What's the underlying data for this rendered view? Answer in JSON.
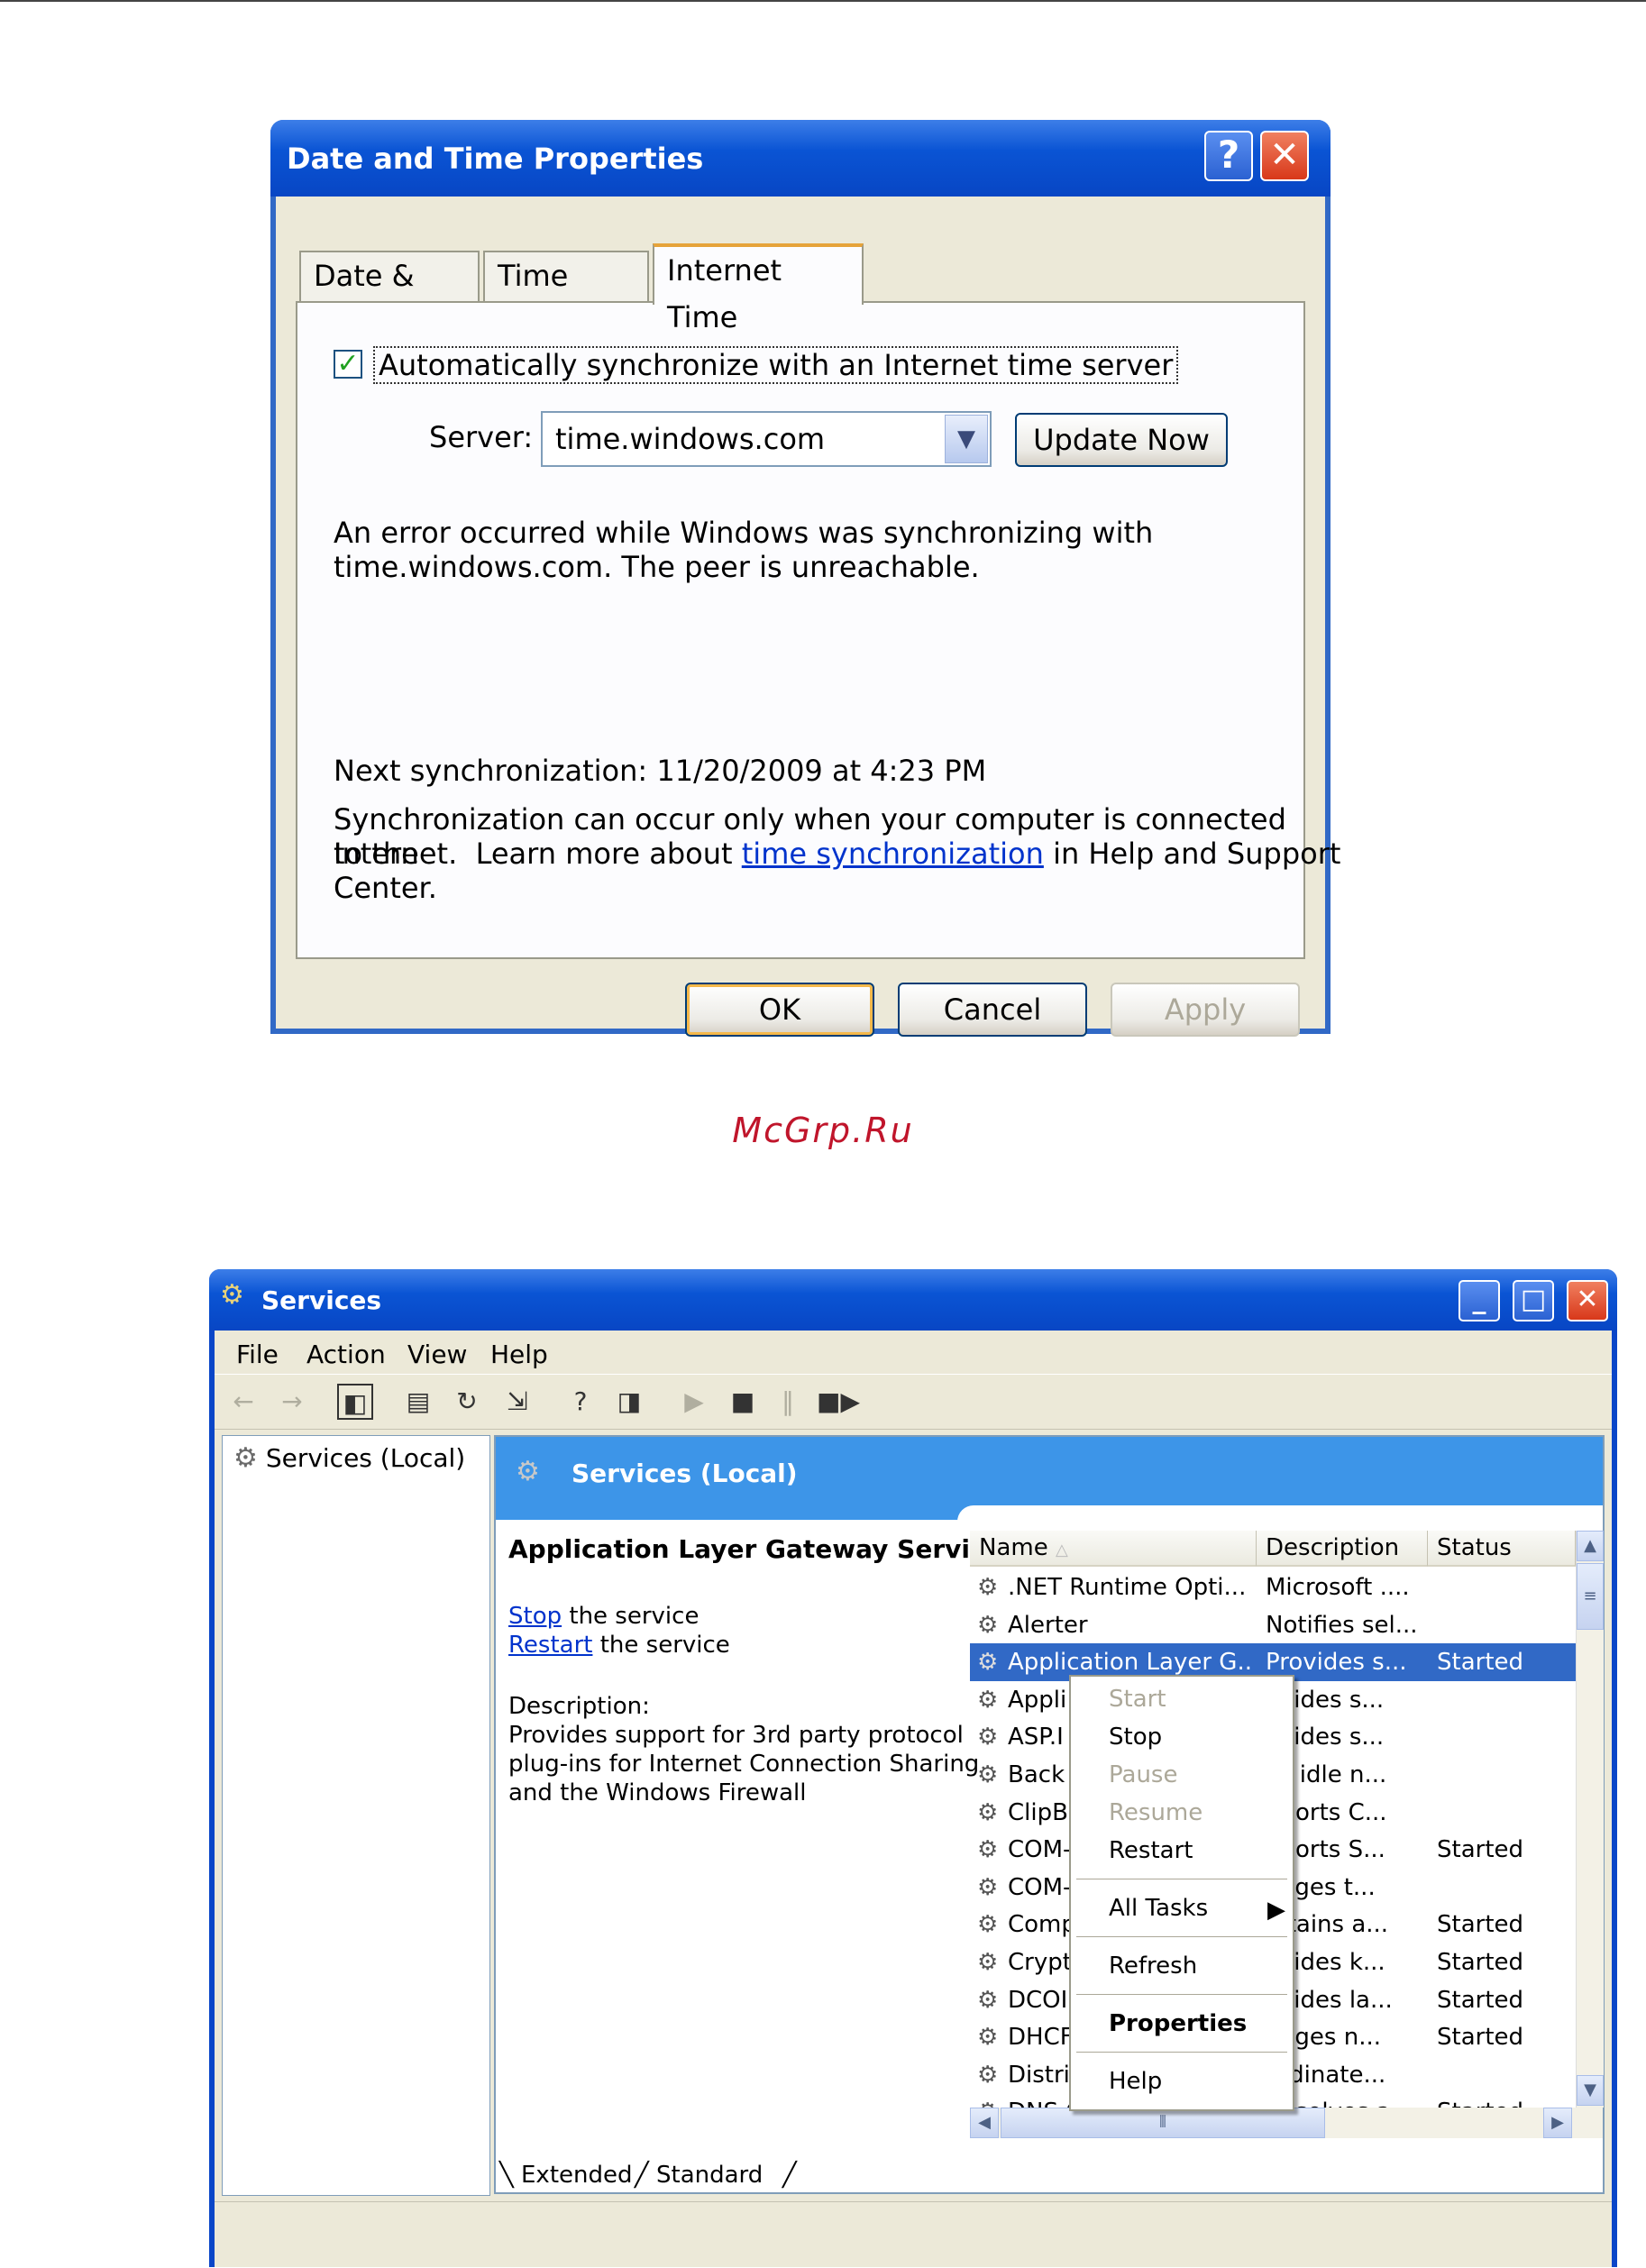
{
  "watermark": "McGrp.Ru",
  "dialog": {
    "title": "Date and Time Properties",
    "help_glyph": "?",
    "close_glyph": "✕",
    "tabs": [
      "Date & Time",
      "Time Zone",
      "Internet Time"
    ],
    "active_tab": "Internet Time",
    "checkbox_label": "Automatically synchronize with an Internet time server",
    "checkbox_checked": true,
    "server_label": "Server:",
    "server_value": "time.windows.com",
    "update_button": "Update Now",
    "error_line1": "An error occurred while Windows was synchronizing with",
    "error_line2": "time.windows.com.  The peer is unreachable.",
    "next_sync": "Next synchronization: 11/20/2009 at 4:23 PM",
    "info_line1": "Synchronization can occur only when your computer is connected to the",
    "info_line2_pre": "Internet.  Learn more about ",
    "info_link": "time synchronization",
    "info_line2_post": " in Help and Support",
    "info_line3": "Center.",
    "ok_button": "OK",
    "cancel_button": "Cancel",
    "apply_button": "Apply"
  },
  "services": {
    "title": "Services",
    "menu": [
      "File",
      "Action",
      "View",
      "Help"
    ],
    "tree_item": "Services (Local)",
    "header_title": "Services (Local)",
    "selected_name": "Application Layer Gateway Service",
    "stop_link": "Stop",
    "stop_suffix": " the service",
    "restart_link": "Restart",
    "restart_suffix": " the service",
    "description_label": "Description:",
    "description_lines": [
      "Provides support for 3rd party protocol",
      "plug-ins for Internet Connection Sharing",
      "and the Windows Firewall"
    ],
    "columns": [
      "Name",
      "Description",
      "Status"
    ],
    "rows": [
      {
        "name": ".NET Runtime Opti...",
        "desc": "Microsoft ....",
        "status": ""
      },
      {
        "name": "Alerter",
        "desc": "Notifies sel...",
        "status": ""
      },
      {
        "name": "Application Layer G...",
        "desc": "Provides s...",
        "status": "Started"
      },
      {
        "name": "Appli",
        "desc": "ovides s...",
        "status": ""
      },
      {
        "name": "ASP.I",
        "desc": "ovides s...",
        "status": ""
      },
      {
        "name": "Back",
        "desc": "es idle n...",
        "status": ""
      },
      {
        "name": "ClipB",
        "desc": "pports C...",
        "status": ""
      },
      {
        "name": "COM-",
        "desc": "pports S...",
        "status": "Started"
      },
      {
        "name": "COM-",
        "desc": "nages t...",
        "status": ""
      },
      {
        "name": "Comp",
        "desc": "intains a...",
        "status": "Started"
      },
      {
        "name": "Crypt",
        "desc": "ovides k...",
        "status": "Started"
      },
      {
        "name": "DCOI",
        "desc": "ovides la...",
        "status": "Started"
      },
      {
        "name": "DHCF",
        "desc": "nages n...",
        "status": "Started"
      },
      {
        "name": "Distri",
        "desc": "ordinate...",
        "status": ""
      },
      {
        "name": "DNS Client",
        "desc": "Resolves a...",
        "status": "Started"
      }
    ],
    "context_menu": {
      "start": "Start",
      "stop": "Stop",
      "pause": "Pause",
      "resume": "Resume",
      "restart": "Restart",
      "all_tasks": "All Tasks",
      "refresh": "Refresh",
      "properties": "Properties",
      "help": "Help"
    },
    "bottom_tabs": [
      "Extended",
      "Standard"
    ]
  }
}
